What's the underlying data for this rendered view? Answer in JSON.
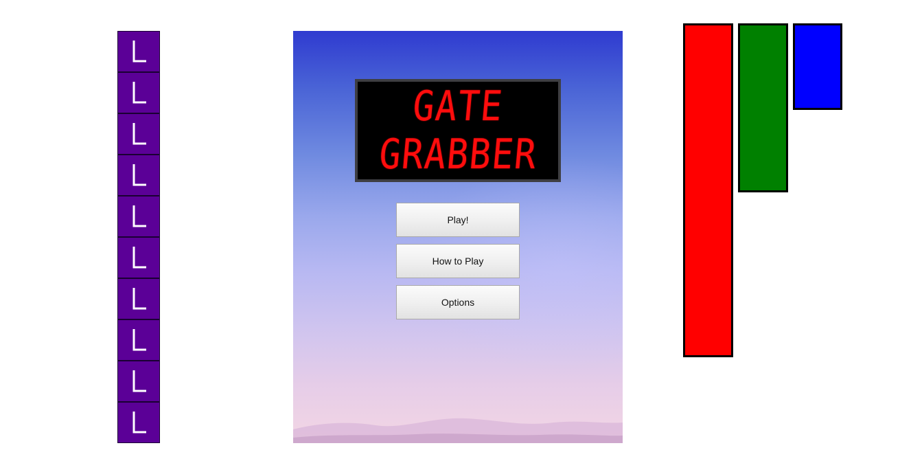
{
  "game": {
    "title_line_1": "GATE",
    "title_line_2": "GRABBER"
  },
  "menu": {
    "play_label": "Play!",
    "how_to_play_label": "How to Play",
    "options_label": "Options"
  },
  "gate_column": {
    "tile_count": 10,
    "tile_glyph": "L",
    "tile_color": "#5b0097"
  },
  "level_bars": [
    {
      "color": "#ff0000",
      "fill_fraction": 1.0
    },
    {
      "color": "#008000",
      "fill_fraction": 0.5
    },
    {
      "color": "#0000ff",
      "fill_fraction": 0.25
    }
  ]
}
